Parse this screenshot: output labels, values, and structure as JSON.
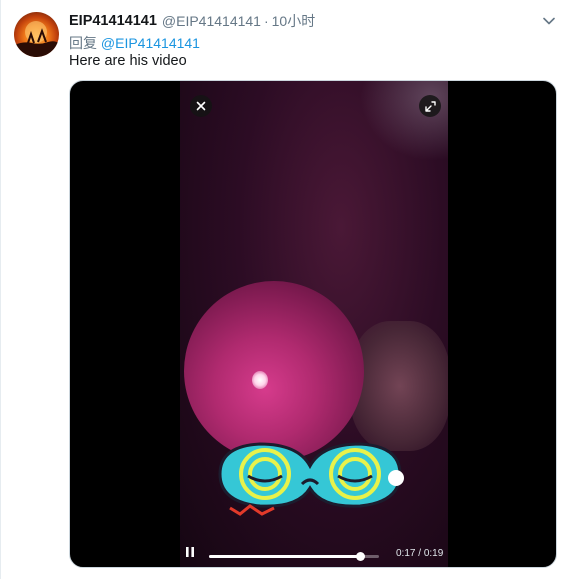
{
  "tweet": {
    "display_name": "EIP41414141",
    "handle": "@EIP41414141",
    "separator": "·",
    "time": "10小时",
    "reply_prefix": "回复",
    "reply_to": "@EIP41414141",
    "text": "Here are his video"
  },
  "media": {
    "type": "video",
    "current_time": "0:17",
    "time_separator": " / ",
    "duration": "0:19",
    "progress": 0.89,
    "state": "playing",
    "icons": {
      "close": "close-icon",
      "expand": "expand-icon",
      "pause": "pause-icon",
      "more": "chevron-down-icon"
    }
  },
  "colors": {
    "link": "#1b95e0",
    "secondary_text": "#657786",
    "primary_text": "#14171a"
  }
}
